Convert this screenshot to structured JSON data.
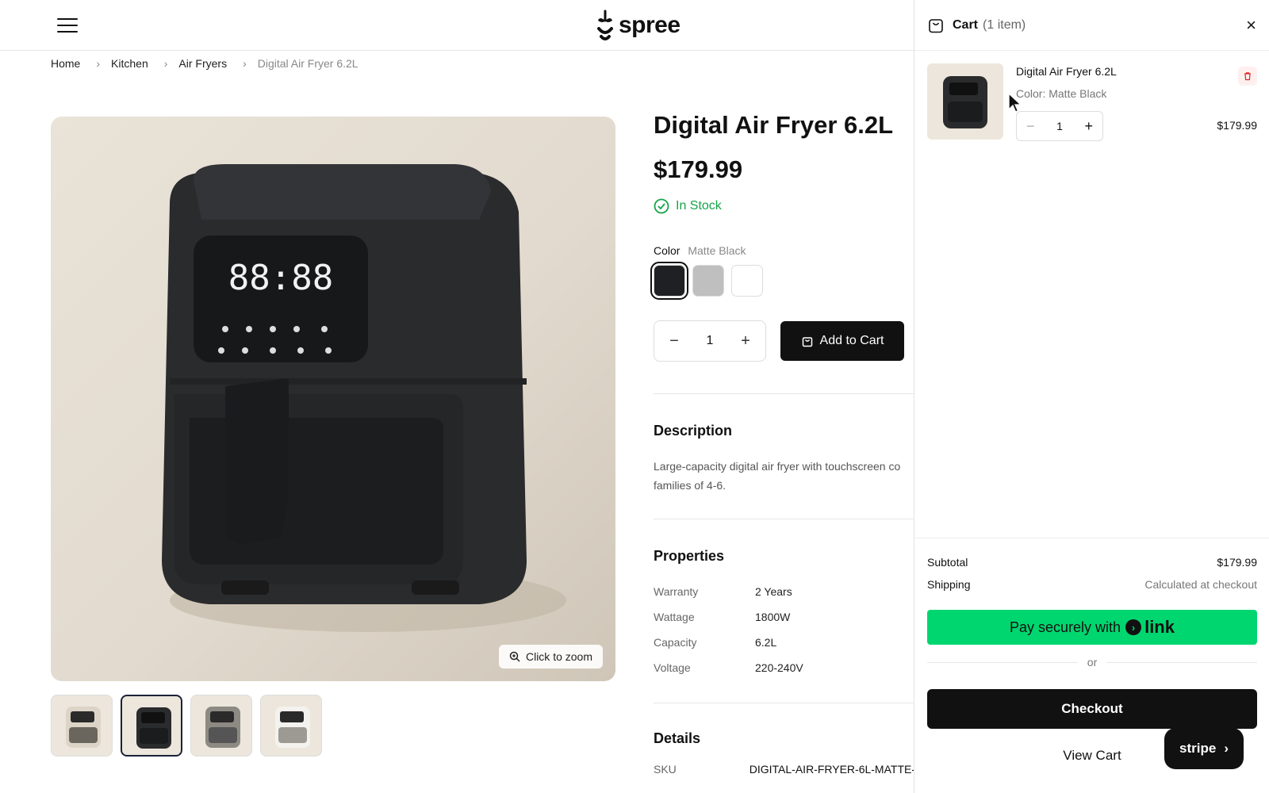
{
  "header": {
    "brand": "spree",
    "menu_icon": "hamburger-icon"
  },
  "breadcrumb": [
    {
      "label": "Home"
    },
    {
      "label": "Kitchen"
    },
    {
      "label": "Air Fryers"
    },
    {
      "label": "Digital Air Fryer 6.2L"
    }
  ],
  "gallery": {
    "zoom_label": "Click to zoom",
    "thumbnails": [
      {
        "variant": "Cream"
      },
      {
        "variant": "Matte Black",
        "active": true
      },
      {
        "variant": "Gray"
      },
      {
        "variant": "White"
      }
    ]
  },
  "product": {
    "title": "Digital Air Fryer 6.2L",
    "price": "$179.99",
    "stock": "In Stock",
    "color_label": "Color",
    "color_value": "Matte Black",
    "swatches": [
      {
        "color": "#1f2023",
        "active": true
      },
      {
        "color": "#bfbfbf"
      },
      {
        "color": "#ffffff"
      }
    ],
    "quantity": "1",
    "add_to_cart": "Add to Cart",
    "description_heading": "Description",
    "description": "Large-capacity digital air fryer with touchscreen co families of 4-6.",
    "properties_heading": "Properties",
    "properties": [
      {
        "key": "Warranty",
        "value": "2 Years"
      },
      {
        "key": "Wattage",
        "value": "1800W"
      },
      {
        "key": "Capacity",
        "value": "6.2L"
      },
      {
        "key": "Voltage",
        "value": "220-240V"
      }
    ],
    "details_heading": "Details",
    "sku_label": "SKU",
    "sku_value": "DIGITAL-AIR-FRYER-6L-MATTE-"
  },
  "cart": {
    "title": "Cart",
    "count": "(1 item)",
    "item": {
      "name": "Digital Air Fryer 6.2L",
      "variant": "Color: Matte Black",
      "quantity": "1",
      "price": "$179.99"
    },
    "subtotal_label": "Subtotal",
    "subtotal_value": "$179.99",
    "shipping_label": "Shipping",
    "shipping_value": "Calculated at checkout",
    "pay_label": "Pay securely with",
    "pay_brand": "link",
    "or_label": "or",
    "checkout_label": "Checkout",
    "view_cart_label": "View Cart",
    "stripe_label": "stripe"
  },
  "colors": {
    "accent_green": "#16a34a",
    "link_green": "#00d66f",
    "primary_dark": "#111111"
  }
}
